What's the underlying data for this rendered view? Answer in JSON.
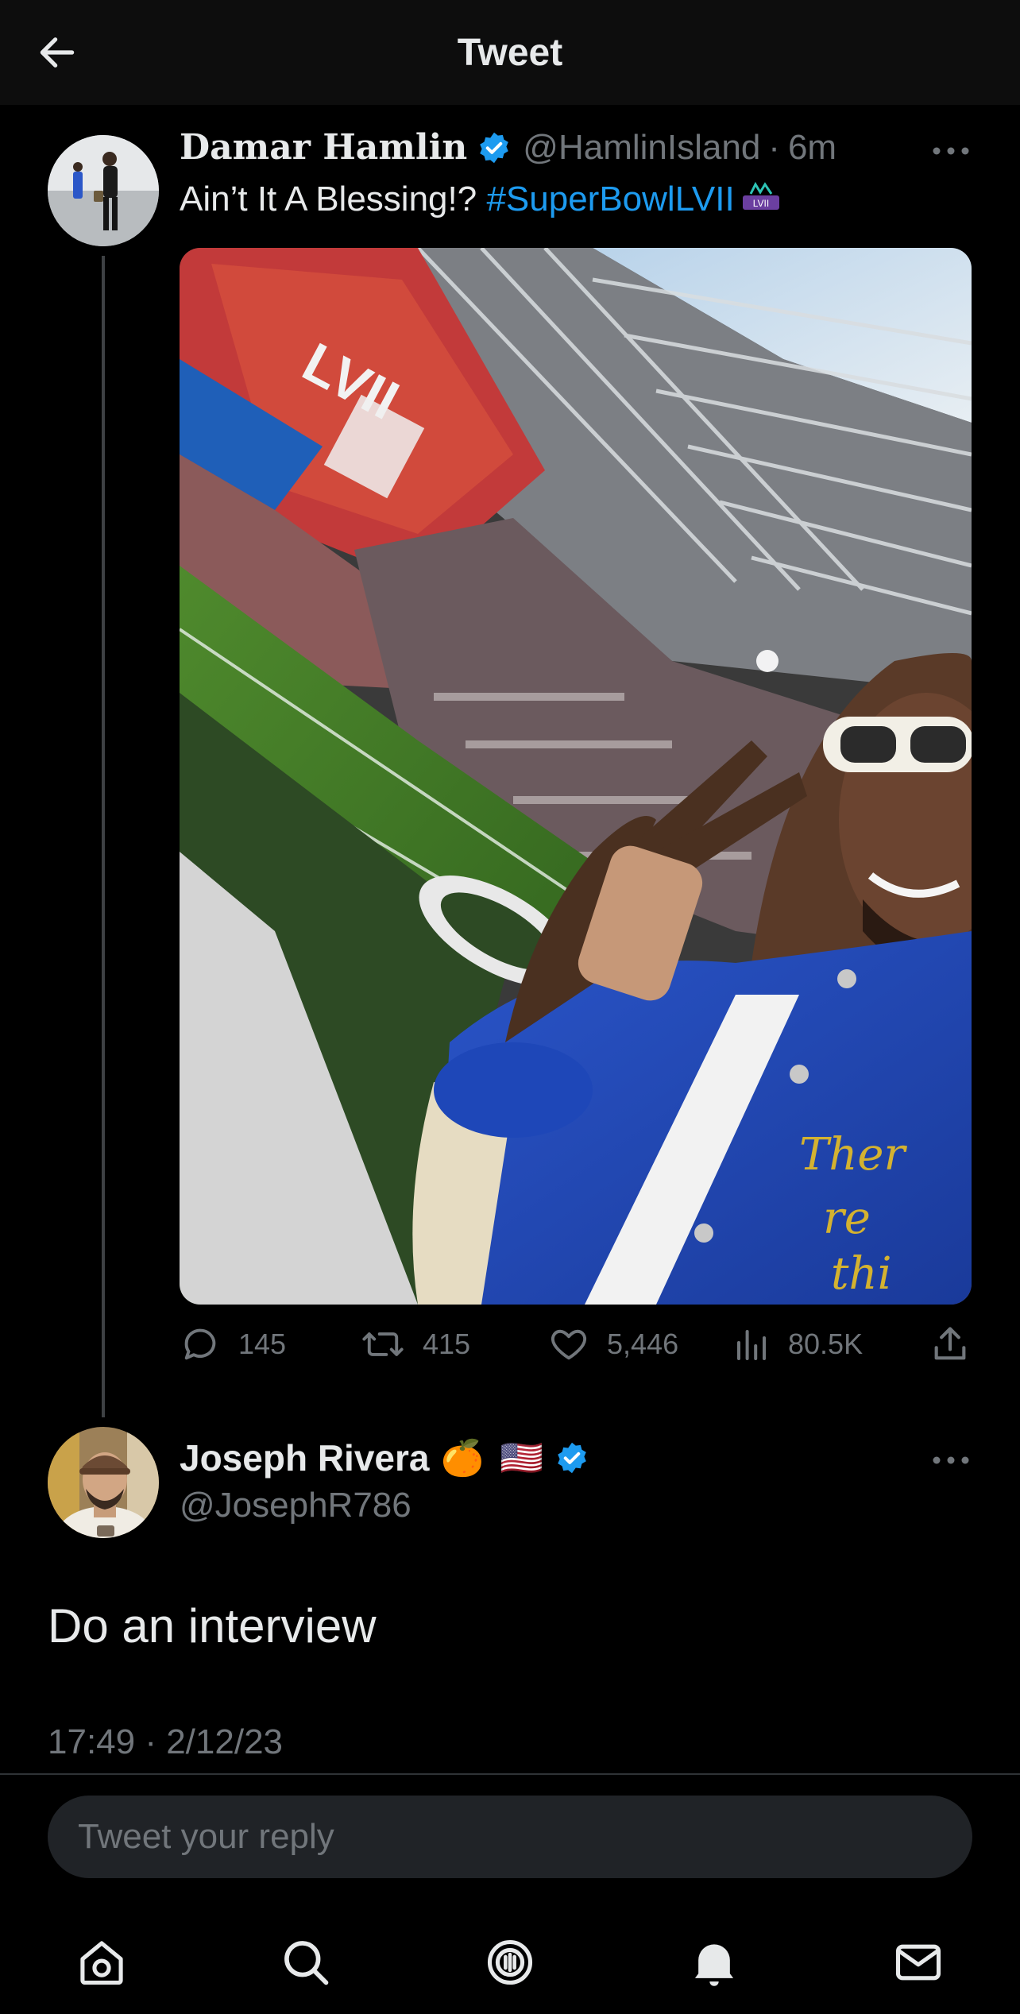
{
  "header": {
    "title": "Tweet"
  },
  "original_tweet": {
    "name": "Damar Hamlin",
    "handle": "@HamlinIsland",
    "separator": "·",
    "time": "6m",
    "text": "Ain’t It A Blessing!? ",
    "hashtag": "#SuperBowlLVII",
    "stats": {
      "replies": "145",
      "retweets": "415",
      "likes": "5,446",
      "views": "80.5K"
    }
  },
  "reply": {
    "name": "Joseph Rivera",
    "emoji": "🍊",
    "flag": "🇺🇸",
    "handle": "@JosephR786",
    "text": "Do an interview",
    "timestamp": "17:49 · 2/12/23"
  },
  "composer": {
    "placeholder": "Tweet your reply"
  },
  "tabbar": [
    "home-icon",
    "search-icon",
    "spaces-icon",
    "notifications-icon",
    "messages-icon"
  ],
  "colors": {
    "accent": "#1d9bf0",
    "muted": "#71767b",
    "text": "#e7e9ea",
    "background": "#000000"
  }
}
